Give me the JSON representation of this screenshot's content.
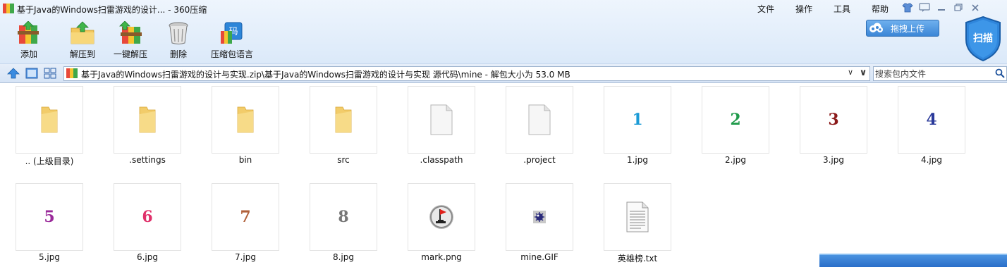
{
  "window": {
    "title": "基于Java的Windows扫雷游戏的设计... - 360压缩",
    "menu": [
      "文件",
      "操作",
      "工具",
      "帮助"
    ]
  },
  "toolbar": {
    "items": [
      {
        "label": "添加",
        "icon": "add-archive-icon"
      },
      {
        "label": "解压到",
        "icon": "extract-to-icon"
      },
      {
        "label": "一键解压",
        "icon": "one-click-extract-icon"
      },
      {
        "label": "删除",
        "icon": "trash-icon"
      },
      {
        "label": "压缩包语言",
        "icon": "archive-language-icon"
      }
    ],
    "upload_label": "拖拽上传",
    "scan_label": "扫描"
  },
  "address_bar": {
    "path": "基于Java的Windows扫雷游戏的设计与实现.zip\\基于Java的Windows扫雷游戏的设计与实现 源代码\\mine - 解包大小为 53.0 MB",
    "search_placeholder": "搜索包内文件"
  },
  "files": [
    {
      "name": ".. (上级目录)",
      "type": "folder"
    },
    {
      "name": ".settings",
      "type": "folder"
    },
    {
      "name": "bin",
      "type": "folder"
    },
    {
      "name": "src",
      "type": "folder"
    },
    {
      "name": ".classpath",
      "type": "file"
    },
    {
      "name": ".project",
      "type": "file"
    },
    {
      "name": "1.jpg",
      "type": "number",
      "digit": "1",
      "color": "#1a9ad6"
    },
    {
      "name": "2.jpg",
      "type": "number",
      "digit": "2",
      "color": "#1f9a4a"
    },
    {
      "name": "3.jpg",
      "type": "number",
      "digit": "3",
      "color": "#8b1a1a"
    },
    {
      "name": "4.jpg",
      "type": "number",
      "digit": "4",
      "color": "#2a3a9a"
    },
    {
      "name": "5.jpg",
      "type": "number",
      "digit": "5",
      "color": "#9a2a9a"
    },
    {
      "name": "6.jpg",
      "type": "number",
      "digit": "6",
      "color": "#e0306a"
    },
    {
      "name": "7.jpg",
      "type": "number",
      "digit": "7",
      "color": "#b0603a"
    },
    {
      "name": "8.jpg",
      "type": "number",
      "digit": "8",
      "color": "#777777"
    },
    {
      "name": "mark.png",
      "type": "mark"
    },
    {
      "name": "mine.GIF",
      "type": "mine"
    },
    {
      "name": "英雄榜.txt",
      "type": "txt"
    }
  ]
}
